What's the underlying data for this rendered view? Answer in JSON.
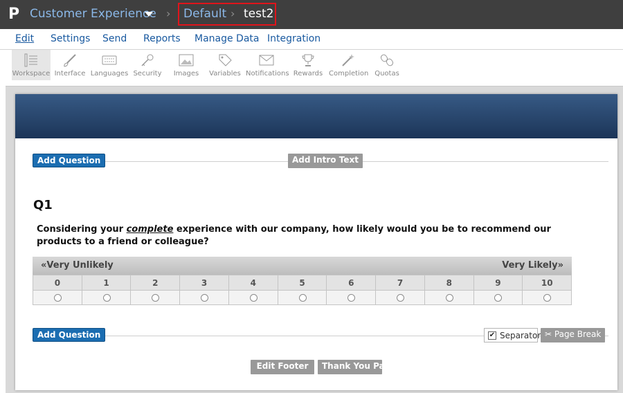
{
  "app": {
    "logo_glyph": "P",
    "name": "Customer Experience",
    "breadcrumb_sep": "›",
    "breadcrumb": [
      "Default",
      "test2"
    ]
  },
  "menu": {
    "items": [
      "Edit",
      "Settings",
      "Send",
      "Reports",
      "Manage Data",
      "Integration"
    ],
    "active": "Edit"
  },
  "toolbar": {
    "items": [
      {
        "label": "Workspace",
        "icon": "workspace-icon"
      },
      {
        "label": "Interface",
        "icon": "brush-icon"
      },
      {
        "label": "Languages",
        "icon": "keyboard-icon"
      },
      {
        "label": "Security",
        "icon": "key-icon"
      },
      {
        "label": "Images",
        "icon": "image-icon"
      },
      {
        "label": "Variables",
        "icon": "tag-icon"
      },
      {
        "label": "Notifications",
        "icon": "envelope-icon"
      },
      {
        "label": "Rewards",
        "icon": "trophy-icon"
      },
      {
        "label": "Completion",
        "icon": "magic-wand-icon"
      },
      {
        "label": "Quotas",
        "icon": "link-icon"
      }
    ],
    "active": "Workspace"
  },
  "survey": {
    "add_question": "Add Question",
    "add_intro": "Add Intro Text",
    "question": {
      "number": "Q1",
      "text_before": "Considering your ",
      "text_emph": "complete",
      "text_after": " experience with our company, how likely would you be to recommend our products to a friend or colleague?"
    },
    "scale": {
      "low_label": "«Very Unlikely",
      "high_label": "Very Likely»",
      "points": [
        "0",
        "1",
        "2",
        "3",
        "4",
        "5",
        "6",
        "7",
        "8",
        "9",
        "10"
      ]
    },
    "separator_label": "Separator",
    "separator_checked": true,
    "page_break": "Page Break",
    "edit_footer": "Edit Footer",
    "thank_you": "Thank You Page"
  },
  "colors": {
    "topbar": "#3f3f3f",
    "link": "#8bb8e8",
    "highlight_box": "#e0141b",
    "header_band": "#2a4670",
    "primary_button": "#1b6db1",
    "secondary_button": "#999999"
  }
}
